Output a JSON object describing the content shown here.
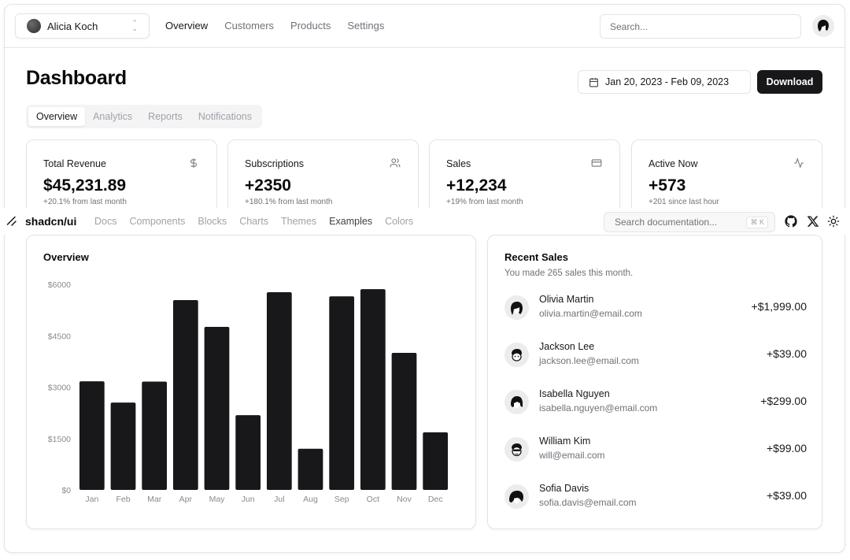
{
  "topnav": {
    "team_name": "Alicia Koch",
    "links": [
      {
        "label": "Overview",
        "active": true
      },
      {
        "label": "Customers",
        "active": false
      },
      {
        "label": "Products",
        "active": false
      },
      {
        "label": "Settings",
        "active": false
      }
    ],
    "search_placeholder": "Search...",
    "user_avatar_icon": "user-avatar-icon"
  },
  "header": {
    "title": "Dashboard",
    "date_range": "Jan 20, 2023 - Feb 09, 2023",
    "download_label": "Download"
  },
  "tabs": [
    {
      "label": "Overview",
      "active": true
    },
    {
      "label": "Analytics",
      "active": false
    },
    {
      "label": "Reports",
      "active": false
    },
    {
      "label": "Notifications",
      "active": false
    }
  ],
  "stats": [
    {
      "title": "Total Revenue",
      "value": "$45,231.89",
      "sub": "+20.1% from last month",
      "icon": "dollar-icon"
    },
    {
      "title": "Subscriptions",
      "value": "+2350",
      "sub": "+180.1% from last month",
      "icon": "users-icon"
    },
    {
      "title": "Sales",
      "value": "+12,234",
      "sub": "+19% from last month",
      "icon": "credit-card-icon"
    },
    {
      "title": "Active Now",
      "value": "+573",
      "sub": "+201 since last hour",
      "icon": "activity-icon"
    }
  ],
  "docs_bar": {
    "brand": "shadcn/ui",
    "links": [
      {
        "label": "Docs",
        "active": false
      },
      {
        "label": "Components",
        "active": false
      },
      {
        "label": "Blocks",
        "active": false
      },
      {
        "label": "Charts",
        "active": false
      },
      {
        "label": "Themes",
        "active": false
      },
      {
        "label": "Examples",
        "active": true
      },
      {
        "label": "Colors",
        "active": false
      }
    ],
    "search_placeholder": "Search documentation...",
    "shortcut": "⌘ K"
  },
  "overview": {
    "title": "Overview"
  },
  "chart_data": {
    "type": "bar",
    "title": "Overview",
    "xlabel": "",
    "ylabel": "",
    "categories": [
      "Jan",
      "Feb",
      "Mar",
      "Apr",
      "May",
      "Jun",
      "Jul",
      "Aug",
      "Sep",
      "Oct",
      "Nov",
      "Dec"
    ],
    "values": [
      3170,
      2550,
      3160,
      5540,
      4760,
      2180,
      5770,
      1200,
      5650,
      5860,
      4000,
      1680
    ],
    "yticks": [
      0,
      1500,
      3000,
      4500,
      6000
    ],
    "ytick_labels": [
      "$0",
      "$1500",
      "$3000",
      "$4500",
      "$6000"
    ],
    "ylim": [
      0,
      6000
    ],
    "grid": false,
    "bar_color": "#18181b"
  },
  "recent_sales": {
    "title": "Recent Sales",
    "subtitle": "You made 265 sales this month.",
    "items": [
      {
        "name": "Olivia Martin",
        "email": "olivia.martin@email.com",
        "amount": "+$1,999.00"
      },
      {
        "name": "Jackson Lee",
        "email": "jackson.lee@email.com",
        "amount": "+$39.00"
      },
      {
        "name": "Isabella Nguyen",
        "email": "isabella.nguyen@email.com",
        "amount": "+$299.00"
      },
      {
        "name": "William Kim",
        "email": "will@email.com",
        "amount": "+$99.00"
      },
      {
        "name": "Sofia Davis",
        "email": "sofia.davis@email.com",
        "amount": "+$39.00"
      }
    ]
  }
}
